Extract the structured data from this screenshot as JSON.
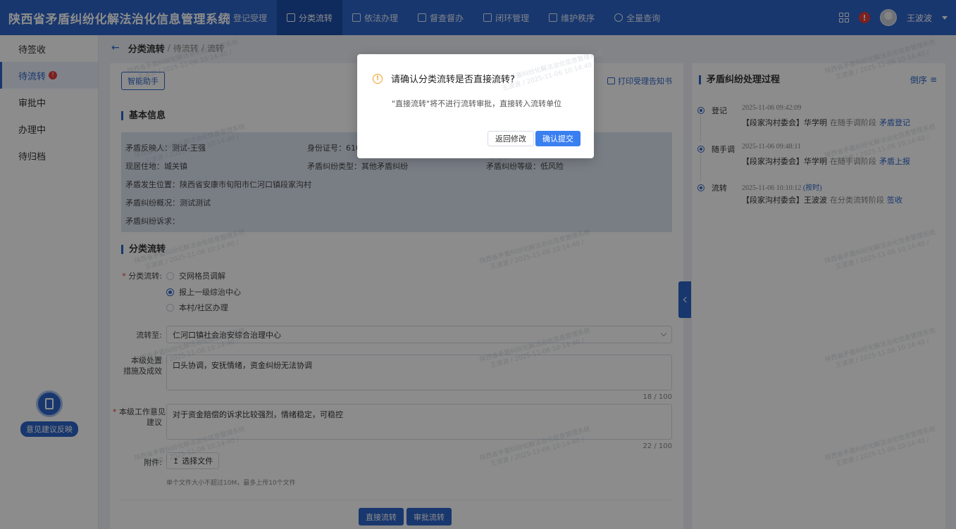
{
  "app": {
    "title": "陕西省矛盾纠纷化解法治化信息管理系统"
  },
  "topnav": [
    {
      "label": "登记受理",
      "active": false
    },
    {
      "label": "分类流转",
      "active": true
    },
    {
      "label": "依法办理",
      "active": false
    },
    {
      "label": "督查督办",
      "active": false
    },
    {
      "label": "闭环管理",
      "active": false
    },
    {
      "label": "维护秩序",
      "active": false
    },
    {
      "label": "全量查询",
      "active": false
    }
  ],
  "user": {
    "name": "王波波",
    "alert_badge": "!"
  },
  "sidebar": {
    "items": [
      {
        "label": "待签收"
      },
      {
        "label": "待流转",
        "badge": "!"
      },
      {
        "label": "审批中"
      },
      {
        "label": "办理中"
      },
      {
        "label": "待归档"
      }
    ],
    "feedback_label": "意见建议反映"
  },
  "breadcrumb": {
    "main": "分类流转",
    "sep": "/",
    "sub1": "待流转",
    "sub2": "流转"
  },
  "main": {
    "assistant_button": "智能助手",
    "print_link": "打印受理告知书",
    "basic_info_title": "基本信息",
    "info": {
      "reporter": "矛盾反映人：测试-王强",
      "id_number": "身份证号：6108",
      "residence": "现居住地：城关镇",
      "dispute_type": "矛盾纠纷类型：其他矛盾纠纷",
      "dispute_level": "矛盾纠纷等级：低风险",
      "location": "矛盾发生位置：陕西省安康市旬阳市仁河口镇段家沟村",
      "summary": "矛盾纠纷概况：测试测试",
      "request": "矛盾纠纷诉求："
    },
    "transfer_title": "分类流转",
    "form": {
      "type_label": "分类流转:",
      "options": [
        "交网格员调解",
        "报上一级综治中心",
        "本村/社区办理"
      ],
      "selected_index": 1,
      "transfer_to_label": "流转至:",
      "transfer_to_value": "仁河口镇社会治安综合治理中心",
      "measures_label_1": "本级处置",
      "measures_label_2": "措施及成效",
      "measures_value": "口头协调，安抚情绪，资金纠纷无法协调",
      "measures_count": "18 / 100",
      "opinion_label_1": "本级工作意见",
      "opinion_label_2": "建议",
      "opinion_value": "对于资金赔偿的诉求比较强烈，情绪稳定，可稳控",
      "opinion_count": "22 / 100",
      "attachment_label": "附件:",
      "upload_button": "选择文件",
      "upload_hint": "单个文件大小不超过10M，最多上传10个文件"
    },
    "direct_button": "直接流转",
    "approval_button": "审批流转"
  },
  "process": {
    "title": "矛盾纠纷处理过程",
    "sort_label": "倒序",
    "items": [
      {
        "type": "登记",
        "time": "2025-11-06 09:42:09",
        "ontime": "",
        "org": "【段家沟村委会】华学明",
        "stage": "在随手调阶段",
        "action": "矛盾登记"
      },
      {
        "type": "随手调",
        "time": "2025-11-06 09:48:11",
        "ontime": "",
        "org": "【段家沟村委会】华学明",
        "stage": "在随手调阶段",
        "action": "矛盾上报"
      },
      {
        "type": "流转",
        "time": "2025-11-06 10:10:12",
        "ontime": "(按时)",
        "org": "【段家沟村委会】王波波",
        "stage": "在分类流转阶段",
        "action": "签收"
      }
    ]
  },
  "modal": {
    "title": "请确认分类流转是否直接流转?",
    "body": "\"直接流转\"将不进行流转审批，直接转入流转单位",
    "cancel": "返回修改",
    "confirm": "确认提交"
  },
  "watermark": {
    "line1": "陕西省矛盾纠纷化解法治化信息管理系统",
    "line2": "王波波 / 2025-11-06 10:14:40 /"
  },
  "colors": {
    "primary": "#2d64c8",
    "danger": "#e23b3b",
    "warning": "#f0a020"
  }
}
